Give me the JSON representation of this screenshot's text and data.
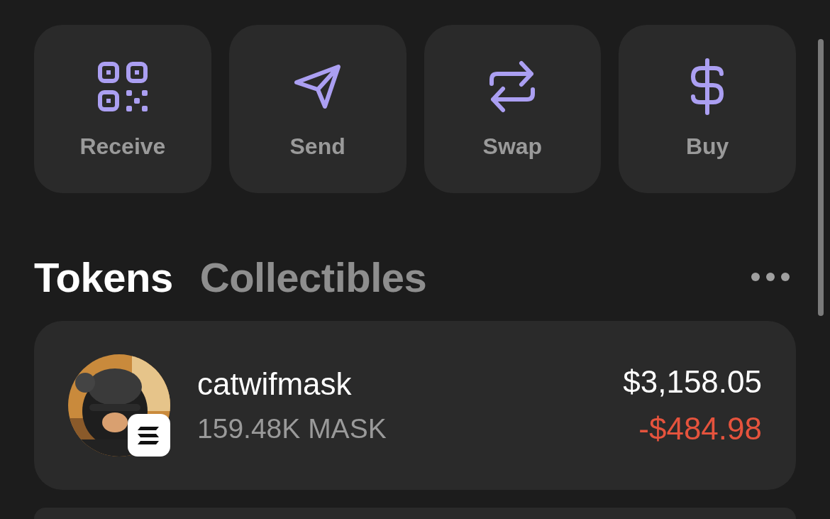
{
  "actions": [
    {
      "label": "Receive",
      "kind": "qr"
    },
    {
      "label": "Send",
      "kind": "send"
    },
    {
      "label": "Swap",
      "kind": "swap"
    },
    {
      "label": "Buy",
      "kind": "dollar"
    }
  ],
  "tabs": [
    {
      "label": "Tokens",
      "selected": true
    },
    {
      "label": "Collectibles",
      "selected": false
    }
  ],
  "tokens": [
    {
      "kind": "picture",
      "name": "catwifmask",
      "amount": "159.48K MASK",
      "value": "$3,158.05",
      "change": "-$484.98",
      "color": "#e5533d"
    }
  ]
}
